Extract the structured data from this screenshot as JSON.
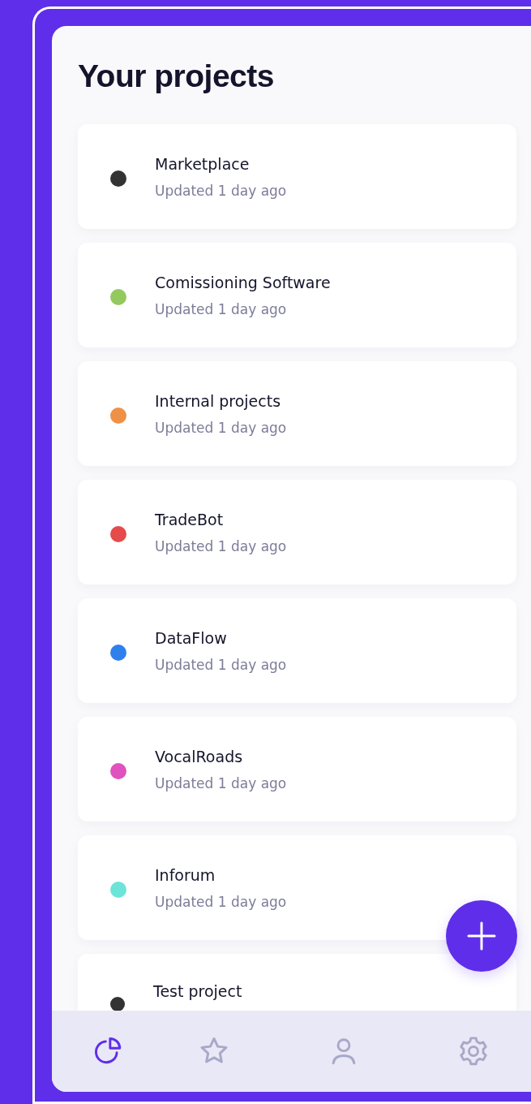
{
  "title": "Your projects",
  "projects": [
    {
      "name": "Marketplace",
      "updated": "Updated 1 day ago",
      "color": "#333333"
    },
    {
      "name": "Comissioning Software",
      "updated": "Updated 1 day ago",
      "color": "#94c95f"
    },
    {
      "name": "Internal projects",
      "updated": "Updated 1 day ago",
      "color": "#ee9147"
    },
    {
      "name": "TradeBot",
      "updated": "Updated 1 day ago",
      "color": "#e54b4b"
    },
    {
      "name": "DataFlow",
      "updated": "Updated 1 day ago",
      "color": "#2f80ed"
    },
    {
      "name": "VocalRoads",
      "updated": "Updated 1 day ago",
      "color": "#e052bd"
    },
    {
      "name": "Inforum",
      "updated": "Updated 1 day ago",
      "color": "#6ce4d8"
    },
    {
      "name": "Test project",
      "color": "#333333"
    }
  ],
  "nav": [
    {
      "kind": "dashboard",
      "selected": true
    },
    {
      "kind": "favorites",
      "selected": false
    },
    {
      "kind": "profile",
      "selected": false
    },
    {
      "kind": "settings",
      "selected": false
    }
  ]
}
